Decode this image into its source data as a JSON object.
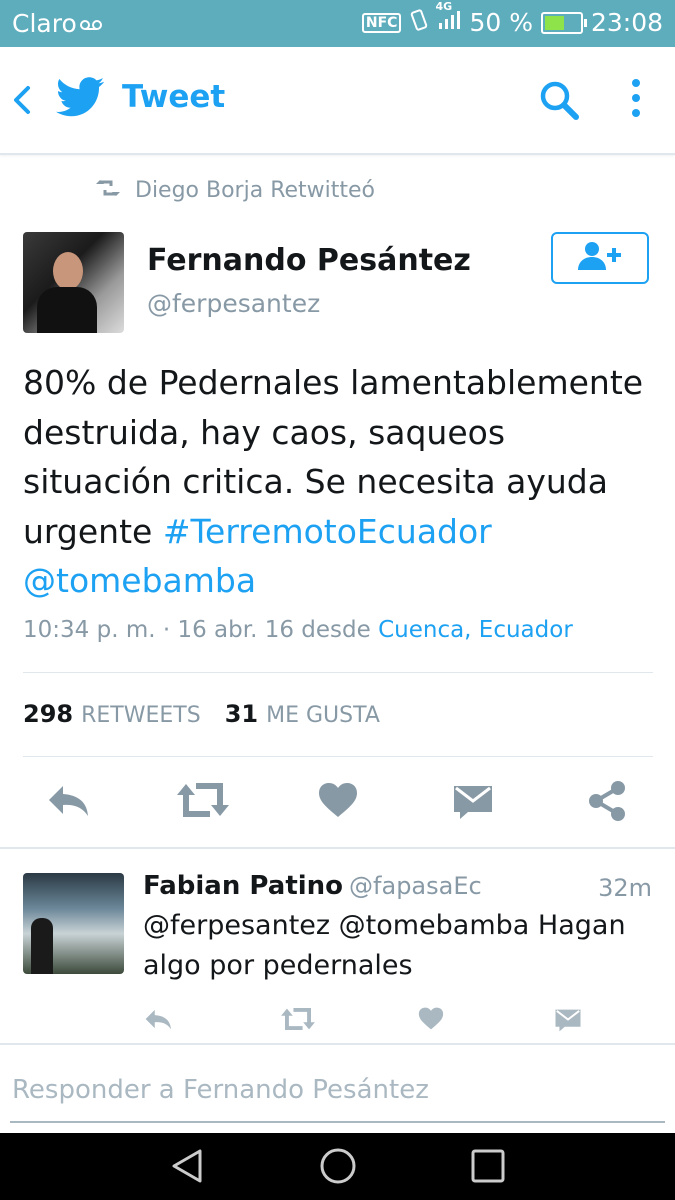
{
  "status_bar": {
    "carrier": "Claro",
    "nfc": "NFC",
    "network": "4G",
    "battery": "50 %",
    "time": "23:08"
  },
  "app_bar": {
    "title": "Tweet",
    "icons": [
      "back-chevron-icon",
      "twitter-bird-icon",
      "search-icon",
      "more-vert-icon"
    ],
    "accent": "#1da1f2"
  },
  "tweet": {
    "retweeted_by": "Diego Borja Retwitteó",
    "author_name": "Fernando Pesántez",
    "author_handle": "@ferpesantez",
    "text_plain": "80% de Pedernales lamentablemente destruida, hay caos, saqueos situación critica. Se necesita ayuda urgente ",
    "hashtag": "#TerremotoEcuador",
    "mention": "@tomebamba",
    "time": "10:34 p. m. · 16 abr. 16",
    "source_prefix": "desde",
    "location": "Cuenca, Ecuador",
    "retweets_count": "298",
    "retweets_label": "RETWEETS",
    "likes_count": "31",
    "likes_label": "ME GUSTA"
  },
  "reply": {
    "name": "Fabian Patino",
    "handle": "@fapasaEc",
    "time": "32m",
    "text": "@ferpesantez @tomebamba Hagan algo por pedernales"
  },
  "compose": {
    "placeholder": "Responder a Fernando Pesántez"
  },
  "colors": {
    "status_bar": "#5eadbd",
    "link": "#1da1f2",
    "muted": "#8899a6",
    "icon": "#8899a6"
  }
}
